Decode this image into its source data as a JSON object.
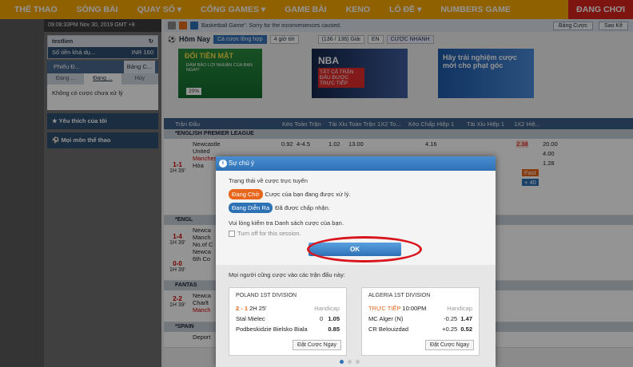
{
  "nav": {
    "items": [
      "THỂ THAO",
      "SÒNG BÀI",
      "QUAY SỐ",
      "CỔNG GAMES",
      "GAME BÀI",
      "KENO",
      "LÔ ĐỀ",
      "NUMBERS GAME"
    ],
    "active": "ĐANG CHƠI"
  },
  "left": {
    "clock": "09:08:33PM Nov 30, 2019 GMT +8",
    "user": "testlien",
    "balance_label": "Số tiền khả dụ...",
    "balance_value": "INR 160",
    "bet_tabs": [
      "Phiếu Đ...",
      "Bảng C..."
    ],
    "sub_tabs": [
      "Đang ...",
      "Đang ...",
      "Hủy"
    ],
    "no_bets": "Không có cược chưa xử lý",
    "favorites": "Yêu thích của tôi",
    "all_sports": "Mọi môn thể thao"
  },
  "ticker": {
    "text": "Basketball Game\". Sorry for the inconveniences caused.",
    "btn1": "Bảng Cược",
    "btn2": "Sao Kê"
  },
  "toolbar": {
    "title": "Hôm Nay",
    "tab": "Cá cược lồng hợp",
    "time": "4 giờ tới",
    "count": "(136 / 136) Giải",
    "lang": "EN",
    "quick": "CƯỢC NHANH"
  },
  "banners": {
    "b1_title": "ĐỔI TIỀN MẶT",
    "b1_sub": "ĐẢM BẢO LỢI NHUẬN CỦA BẠN NGAY!",
    "b1_pct": "20%",
    "b2_title": "NBA",
    "b2_sub": "TẤT CẢ TRẬN ĐẤU ĐƯỢC TRỰC TIẾP",
    "b3_title": "Hãy trải nghiệm cược mới cho phạt góc"
  },
  "table": {
    "headers": [
      "Trận Đấu",
      "Kèo Toàn Trận",
      "Tài Xỉu Toàn Trận",
      "1X2 To...",
      "Kèo Chấp Hiệp 1",
      "Tài Xỉu Hiệp 1",
      "1X2 Hiệ..."
    ],
    "league1": "*ENGLISH PREMIER LEAGUE",
    "league2": "*ENGL",
    "league3": "FANTAS",
    "league4": "*SPAIN",
    "m1": {
      "score": "1-1",
      "time": "1H 39'",
      "home": "Newcastle United",
      "away": "Manchester City",
      "draw": "Hòa",
      "r1": [
        "0.92",
        "4-4.5",
        "1.02",
        "13.00",
        "0",
        "4.16",
        "2.5",
        "2.38",
        "20.00"
      ],
      "r2": [
        "1.00",
        "",
        "0.88",
        "1.31",
        "",
        "4.00"
      ],
      "r3": [
        "1.28"
      ],
      "fast": "Fast",
      "plus": "+ 40"
    },
    "m2": {
      "score": "1-4",
      "time": "1H 39'",
      "home": "Newca",
      "away": "Manch",
      "extra": "No.of C"
    },
    "m3": {
      "score": "0-0",
      "time": "1H 39'",
      "home": "Newca",
      "away": "6th Co",
      "extra": "Manch",
      "extra2": "Corne"
    },
    "m4": {
      "score": "2-2",
      "time": "1H 39'",
      "home": "Newca",
      "away": "Charlt",
      "extra": "Manch",
      "extra2": "Sheffi"
    },
    "m5": {
      "home": "Deport"
    }
  },
  "dialog": {
    "title": "Sự chú ý",
    "heading": "Trạng thái về cược trực tuyến",
    "pending_badge": "Đang Chờ",
    "pending_text": "Cược của bạn đang được xử lý.",
    "running_badge": "Đang Diễn Ra",
    "running_text": "Đã được chấp nhận.",
    "check_text": "Vui lòng kiểm tra Danh sách cược của bạn.",
    "turn_off": "Turn off for this session.",
    "ok": "OK",
    "others": "Mọi người cũng cược vào các trận đấu này:",
    "c1": {
      "league": "POLAND 1ST DIVISION",
      "score": "2 - 1",
      "time": "2H 25'",
      "type": "Handicap",
      "home": "Stal Mielec",
      "h_line": "0",
      "h_odd": "1.05",
      "away": "Podbeskidzie Bielsko Biala",
      "a_odd": "0.85",
      "bet": "Đặt Cược Ngay"
    },
    "c2": {
      "league": "ALGERIA 1ST DIVISION",
      "live": "TRỰC TIẾP",
      "time": "10:00PM",
      "type": "Handicap",
      "home": "MC Alger (N)",
      "h_line": "-0.25",
      "h_odd": "1.47",
      "away": "CR Belouizdad",
      "a_line": "+0.25",
      "a_odd": "0.52",
      "bet": "Đặt Cược Ngay"
    }
  },
  "colors": {
    "accent": "#f7a700",
    "active": "#d9241c",
    "blue": "#2e72b6",
    "ring": "#d8141c",
    "pending": "#e8661b"
  }
}
